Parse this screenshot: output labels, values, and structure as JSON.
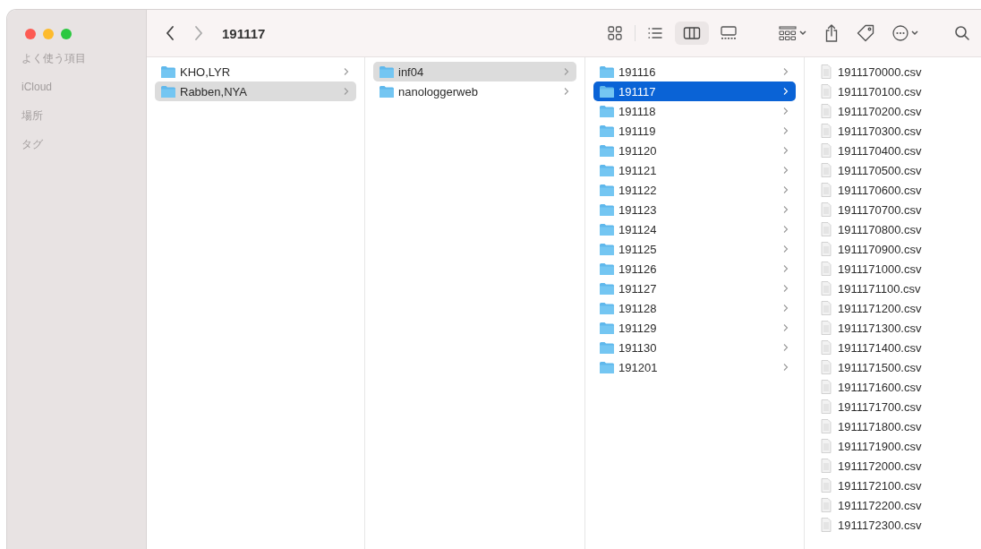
{
  "window": {
    "title": "191117"
  },
  "toolbar": {
    "view_buttons": [
      {
        "kind": "icons",
        "selected": false
      },
      {
        "kind": "list",
        "selected": false
      },
      {
        "kind": "columns",
        "selected": true
      },
      {
        "kind": "gallery",
        "selected": false
      }
    ]
  },
  "sidebar": {
    "items": [
      "よく使う項目",
      "iCloud",
      "場所",
      "タグ"
    ]
  },
  "columns": [
    {
      "items": [
        {
          "kind": "folder",
          "name": "KHO,LYR",
          "selected": false
        },
        {
          "kind": "folder",
          "name": "Rabben,NYA",
          "selected": true
        }
      ]
    },
    {
      "items": [
        {
          "kind": "folder",
          "name": "inf04",
          "selected": true
        },
        {
          "kind": "folder",
          "name": "nanologgerweb",
          "selected": false
        }
      ]
    },
    {
      "items": [
        {
          "kind": "folder",
          "name": "191116",
          "selected": false
        },
        {
          "kind": "folder",
          "name": "191117",
          "selected": true
        },
        {
          "kind": "folder",
          "name": "191118",
          "selected": false
        },
        {
          "kind": "folder",
          "name": "191119",
          "selected": false
        },
        {
          "kind": "folder",
          "name": "191120",
          "selected": false
        },
        {
          "kind": "folder",
          "name": "191121",
          "selected": false
        },
        {
          "kind": "folder",
          "name": "191122",
          "selected": false
        },
        {
          "kind": "folder",
          "name": "191123",
          "selected": false
        },
        {
          "kind": "folder",
          "name": "191124",
          "selected": false
        },
        {
          "kind": "folder",
          "name": "191125",
          "selected": false
        },
        {
          "kind": "folder",
          "name": "191126",
          "selected": false
        },
        {
          "kind": "folder",
          "name": "191127",
          "selected": false
        },
        {
          "kind": "folder",
          "name": "191128",
          "selected": false
        },
        {
          "kind": "folder",
          "name": "191129",
          "selected": false
        },
        {
          "kind": "folder",
          "name": "191130",
          "selected": false
        },
        {
          "kind": "folder",
          "name": "191201",
          "selected": false
        }
      ]
    },
    {
      "items": [
        {
          "kind": "file",
          "name": "1911170000.csv",
          "selected": false
        },
        {
          "kind": "file",
          "name": "1911170100.csv",
          "selected": false
        },
        {
          "kind": "file",
          "name": "1911170200.csv",
          "selected": false
        },
        {
          "kind": "file",
          "name": "1911170300.csv",
          "selected": false
        },
        {
          "kind": "file",
          "name": "1911170400.csv",
          "selected": false
        },
        {
          "kind": "file",
          "name": "1911170500.csv",
          "selected": false
        },
        {
          "kind": "file",
          "name": "1911170600.csv",
          "selected": false
        },
        {
          "kind": "file",
          "name": "1911170700.csv",
          "selected": false
        },
        {
          "kind": "file",
          "name": "1911170800.csv",
          "selected": false
        },
        {
          "kind": "file",
          "name": "1911170900.csv",
          "selected": false
        },
        {
          "kind": "file",
          "name": "1911171000.csv",
          "selected": false
        },
        {
          "kind": "file",
          "name": "1911171100.csv",
          "selected": false
        },
        {
          "kind": "file",
          "name": "1911171200.csv",
          "selected": false
        },
        {
          "kind": "file",
          "name": "1911171300.csv",
          "selected": false
        },
        {
          "kind": "file",
          "name": "1911171400.csv",
          "selected": false
        },
        {
          "kind": "file",
          "name": "1911171500.csv",
          "selected": false
        },
        {
          "kind": "file",
          "name": "1911171600.csv",
          "selected": false
        },
        {
          "kind": "file",
          "name": "1911171700.csv",
          "selected": false
        },
        {
          "kind": "file",
          "name": "1911171800.csv",
          "selected": false
        },
        {
          "kind": "file",
          "name": "1911171900.csv",
          "selected": false
        },
        {
          "kind": "file",
          "name": "1911172000.csv",
          "selected": false
        },
        {
          "kind": "file",
          "name": "1911172100.csv",
          "selected": false
        },
        {
          "kind": "file",
          "name": "1911172200.csv",
          "selected": false
        },
        {
          "kind": "file",
          "name": "1911172300.csv",
          "selected": false
        }
      ]
    }
  ]
}
